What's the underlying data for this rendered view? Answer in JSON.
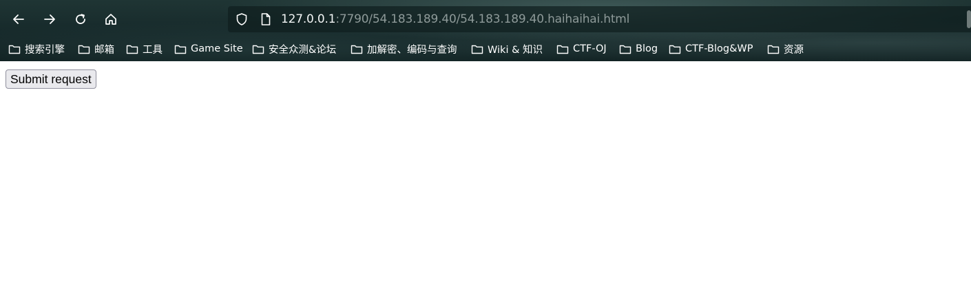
{
  "browser": {
    "url": {
      "host": "127.0.0.1",
      "rest": ":7790/54.183.189.40/54.183.189.40.haihaihai.html"
    },
    "nav": {
      "back_icon": "arrow-left",
      "forward_icon": "arrow-right",
      "reload_icon": "reload",
      "home_icon": "home"
    },
    "bookmarks": [
      {
        "label": "搜索引擎"
      },
      {
        "label": "邮箱"
      },
      {
        "label": "工具"
      },
      {
        "label": "Game Site"
      },
      {
        "label": "安全众测&论坛"
      },
      {
        "label": "加解密、编码与查询"
      },
      {
        "label": "Wiki & 知识"
      },
      {
        "label": "CTF-OJ"
      },
      {
        "label": "Blog"
      },
      {
        "label": "CTF-Blog&WP"
      },
      {
        "label": "资源"
      }
    ]
  },
  "page": {
    "submit_label": "Submit request"
  }
}
